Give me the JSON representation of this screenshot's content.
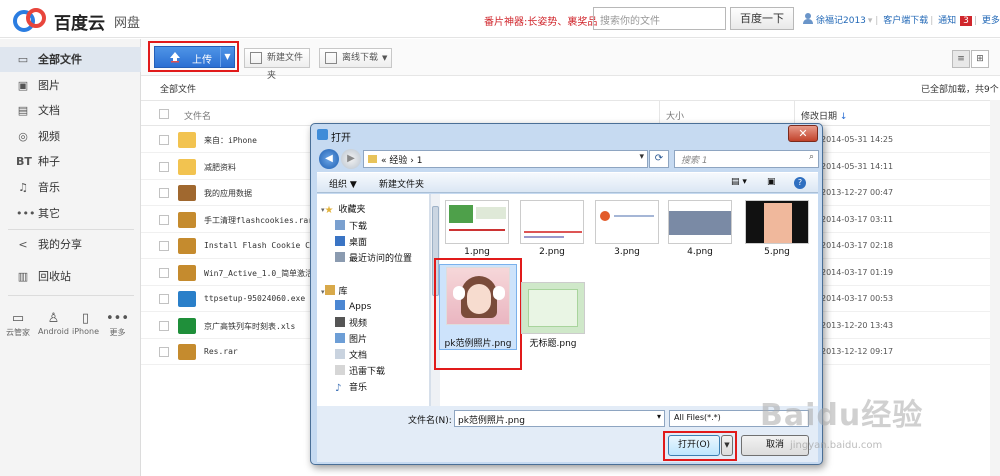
{
  "header": {
    "brand": "百度云",
    "product": "网盘",
    "promo": "番片神器:长姿势、裹奖品",
    "search_placeholder": "搜索你的文件",
    "search_button": "百度一下",
    "user": "徐福记2013",
    "links": [
      "客户端下载",
      "通知",
      "更多"
    ],
    "notice_count": "3"
  },
  "sidebar": {
    "items": [
      {
        "label": "全部文件",
        "icon": "doc-icon"
      },
      {
        "label": "图片",
        "icon": "image-icon"
      },
      {
        "label": "文档",
        "icon": "document-icon"
      },
      {
        "label": "视频",
        "icon": "video-icon"
      },
      {
        "label": "种子",
        "icon": "bt-icon"
      },
      {
        "label": "音乐",
        "icon": "music-icon"
      },
      {
        "label": "其它",
        "icon": "more-icon"
      }
    ],
    "share": "我的分享",
    "recycle": "回收站",
    "devices": [
      "云管家",
      "Android",
      "iPhone",
      "更多"
    ]
  },
  "toolbar": {
    "upload": "上传",
    "new_folder": "新建文件夹",
    "offline": "离线下载"
  },
  "crumb": "全部文件",
  "loaded_text": "已全部加载，共9个",
  "table": {
    "col_name": "文件名",
    "col_size": "大小",
    "col_date": "修改日期",
    "rows": [
      {
        "name": "来自：iPhone",
        "date": "2014-05-31 14:25",
        "type": "folder"
      },
      {
        "name": "减肥资料",
        "date": "2014-05-31 14:11",
        "type": "folder"
      },
      {
        "name": "我的应用数据",
        "date": "2013-12-27 00:47",
        "type": "app-folder"
      },
      {
        "name": "手工清理flashcookies.rar",
        "date": "2014-03-17 03:11",
        "type": "rar"
      },
      {
        "name": "Install Flash Cookie Clea",
        "date": "2014-03-17 02:18",
        "type": "rar"
      },
      {
        "name": "Win7_Active_1.0_简单激活工",
        "date": "2014-03-17 01:19",
        "type": "rar"
      },
      {
        "name": "ttpsetup-95024060.exe",
        "date": "2014-03-17 00:53",
        "type": "exe"
      },
      {
        "name": "京广高铁列车时刻表.xls",
        "date": "2013-12-20 13:43",
        "type": "xls"
      },
      {
        "name": "Res.rar",
        "date": "2013-12-12 09:17",
        "type": "rar"
      }
    ]
  },
  "dialog": {
    "title": "打开",
    "address": "« 经验 › 1",
    "search_placeholder": "搜索 1",
    "organize": "组织 ▼",
    "new_folder": "新建文件夹",
    "nav": {
      "favorites": "收藏夹",
      "fav_items": [
        "下载",
        "桌面",
        "最近访问的位置"
      ],
      "library": "库",
      "lib_items": [
        "Apps",
        "视频",
        "图片",
        "文档",
        "迅雷下载",
        "音乐"
      ]
    },
    "files": [
      "1.png",
      "2.png",
      "3.png",
      "4.png",
      "5.png",
      "pk范例照片.png",
      "无标题.png"
    ],
    "filename_label": "文件名(N):",
    "filename_value": "pk范例照片.png",
    "filetype": "All Files(*.*)",
    "open_button": "打开(O)",
    "cancel_button": "取消"
  },
  "watermark": "Baidu经验",
  "watermark_url": "jingyan.baidu.com"
}
